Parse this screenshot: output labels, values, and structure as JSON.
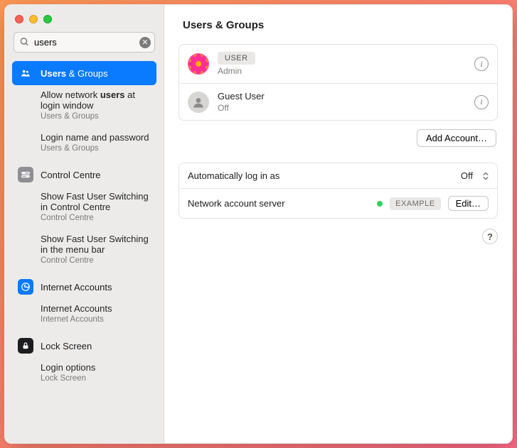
{
  "search": {
    "value": "users"
  },
  "sidebar": {
    "selected": {
      "label_prefix": "Users",
      "label_suffix": " & Groups"
    },
    "selected_sub": [
      {
        "text_a": "Allow network ",
        "text_b": "users",
        "text_c": " at login window",
        "crumb": "Users & Groups"
      },
      {
        "text_a": "Login name and password",
        "text_b": "",
        "text_c": "",
        "crumb": "Users & Groups"
      }
    ],
    "control_centre": {
      "label": "Control Centre",
      "sub": [
        {
          "text": "Show Fast User Switching in Control Centre",
          "crumb": "Control Centre"
        },
        {
          "text": "Show Fast User Switching in the menu bar",
          "crumb": "Control Centre"
        }
      ]
    },
    "internet_accounts": {
      "label": "Internet Accounts",
      "sub": [
        {
          "text": "Internet Accounts",
          "crumb": "Internet Accounts"
        }
      ]
    },
    "lock_screen": {
      "label": "Lock Screen",
      "sub": [
        {
          "text": "Login options",
          "crumb": "Lock Screen"
        }
      ]
    }
  },
  "main": {
    "title": "Users & Groups",
    "users": [
      {
        "name": "USER",
        "role": "Admin",
        "badge": true
      },
      {
        "name": "Guest User",
        "role": "Off",
        "badge": false
      }
    ],
    "add_account": "Add Account…",
    "auto_login": {
      "label": "Automatically log in as",
      "value": "Off"
    },
    "network_server": {
      "label": "Network account server",
      "tag": "EXAMPLE",
      "edit": "Edit…"
    },
    "help": "?"
  }
}
